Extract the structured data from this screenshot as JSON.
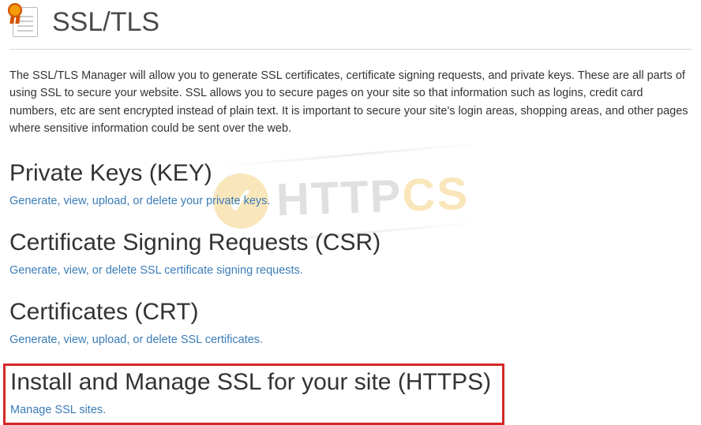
{
  "header": {
    "title": "SSL/TLS"
  },
  "intro": "The SSL/TLS Manager will allow you to generate SSL certificates, certificate signing requests, and private keys. These are all parts of using SSL to secure your website. SSL allows you to secure pages on your site so that information such as logins, credit card numbers, etc are sent encrypted instead of plain text. It is important to secure your site's login areas, shopping areas, and other pages where sensitive information could be sent over the web.",
  "sections": {
    "keys": {
      "heading": "Private Keys (KEY)",
      "link": "Generate, view, upload, or delete your private keys."
    },
    "csr": {
      "heading": "Certificate Signing Requests (CSR)",
      "link": "Generate, view, or delete SSL certificate signing requests."
    },
    "crt": {
      "heading": "Certificates (CRT)",
      "link": "Generate, view, upload, or delete SSL certificates."
    },
    "install": {
      "heading": "Install and Manage SSL for your site (HTTPS)",
      "link": "Manage SSL sites."
    }
  },
  "watermark": {
    "text1": "HTTP",
    "text2": "CS"
  }
}
